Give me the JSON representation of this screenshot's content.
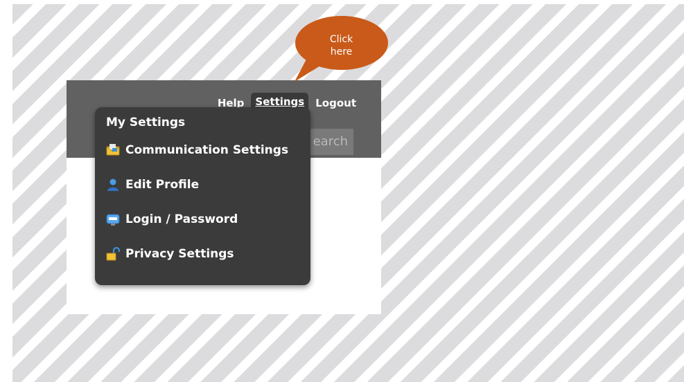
{
  "header": {
    "links": {
      "help": "Help",
      "settings": "Settings",
      "logout": "Logout"
    },
    "search_placeholder": "earch"
  },
  "settings_menu": {
    "heading": "My Settings",
    "items": [
      {
        "label": "Communication Settings",
        "icon": "envelope-icon"
      },
      {
        "label": "Edit Profile",
        "icon": "user-icon"
      },
      {
        "label": "Login / Password",
        "icon": "login-screen-icon"
      },
      {
        "label": "Privacy Settings",
        "icon": "padlock-icon"
      }
    ]
  },
  "callout": {
    "line1": "Click",
    "line2": "here",
    "color": "#c95a19"
  },
  "colors": {
    "topbar": "#616161",
    "menu_bg": "#3b3b3b",
    "stripe": "#dcdcde"
  }
}
